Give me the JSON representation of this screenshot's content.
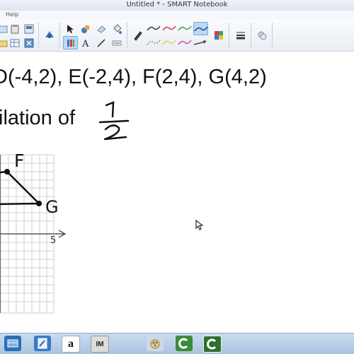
{
  "window": {
    "title": "Untitled * - SMART Notebook"
  },
  "menu": {
    "help": "Help"
  },
  "page": {
    "line1": "D(-4,2), E(-2,4), F(2,4), G(4,2)",
    "line2": "ilation of",
    "handwriting": {
      "fraction_numerator": "1",
      "fraction_denominator": "2",
      "label_f": "F",
      "label_g": "G",
      "axis_tick": "5"
    }
  },
  "taskbar": {
    "amazon_label": "a",
    "im_label": "IM"
  },
  "colors": {
    "accent": "#3b78c8",
    "pen_red": "#e8324f",
    "pen_green": "#3aa84a",
    "pen_pink": "#d84ab8",
    "taskbar_green": "#3c8a3c"
  }
}
